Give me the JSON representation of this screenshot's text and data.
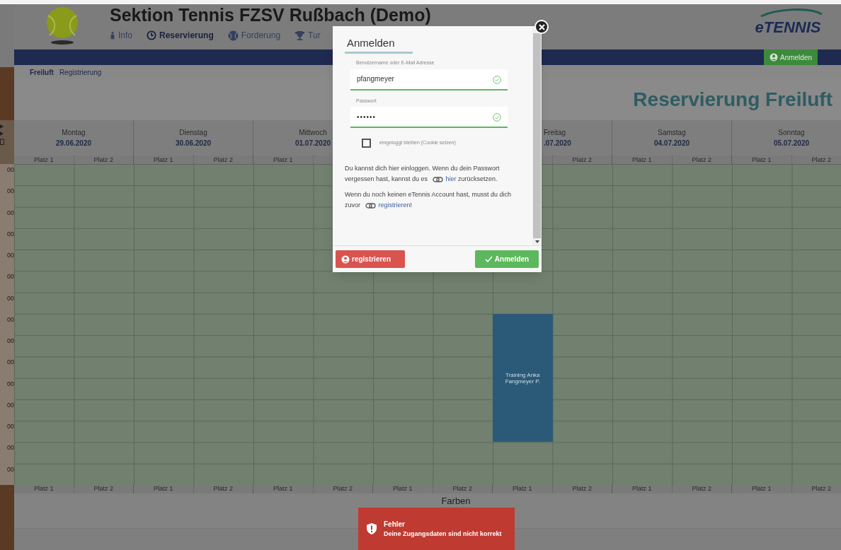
{
  "header": {
    "title": "Sektion Tennis FZSV Rußbach (Demo)",
    "nav": [
      {
        "label": "Info",
        "selected": false
      },
      {
        "label": "Reservierung",
        "selected": true
      },
      {
        "label": "Forderung",
        "selected": false
      },
      {
        "label": "Tur",
        "selected": false
      }
    ],
    "brand": "eTENNIS",
    "login_button": "Anmelden"
  },
  "subnav": [
    {
      "label": "Freiluft",
      "selected": true
    },
    {
      "label": "Registrierung",
      "selected": false
    }
  ],
  "page_title": "Reservierung Freiluft",
  "days_left": [
    {
      "label": "Montag",
      "date": "29.06.2020",
      "cut": false
    },
    {
      "label": "Dienstag",
      "date": "30.06.2020",
      "cut": false
    },
    {
      "label": "Mittwoch",
      "date": "01.07.2020",
      "cut": false
    }
  ],
  "days_right": [
    {
      "label": "Freitag",
      "date": ".07.2020",
      "cut": true
    },
    {
      "label": "Samstag",
      "date": "04.07.2020",
      "cut": false
    },
    {
      "label": "Sonntag",
      "date": "05.07.2020",
      "cut": false
    }
  ],
  "courts_top_left": [
    {
      "label": "Platz 1"
    },
    {
      "label": "Platz 2"
    },
    {
      "label": "Platz 1"
    },
    {
      "label": "Platz 2"
    },
    {
      "label": "Platz 1"
    }
  ],
  "courts_top_right": [
    {
      "label": "Platz 2"
    },
    {
      "label": "Platz 1"
    },
    {
      "label": "Platz 2"
    },
    {
      "label": "Platz 1"
    },
    {
      "label": "Platz 2"
    }
  ],
  "courts_bottom": [
    {
      "label": "Platz 1"
    },
    {
      "label": "Platz 2"
    },
    {
      "label": "Platz 1"
    },
    {
      "label": "Platz 2"
    },
    {
      "label": "Platz 1"
    },
    {
      "label": "Platz 2"
    },
    {
      "label": "Platz 1"
    },
    {
      "label": "Platz 2"
    },
    {
      "label": "Platz 1"
    },
    {
      "label": "Platz 2"
    },
    {
      "label": "Platz 1"
    },
    {
      "label": "Platz 2"
    },
    {
      "label": "Platz 1"
    },
    {
      "label": "Platz 2"
    }
  ],
  "time_labels": [
    "00",
    "00",
    "00",
    "00",
    "00",
    "00",
    "00",
    "00",
    "00",
    "00",
    "00",
    "00",
    "00",
    "00",
    "00"
  ],
  "booking": {
    "text": "Training Anka Fangmeyer P."
  },
  "legend_title": "Farben",
  "login_dialog": {
    "title": "Anmelden",
    "fields": [
      {
        "label": "Benutzername oder E-Mail Adresse",
        "value": "pfangmeyer",
        "kind": "text",
        "valid": true
      },
      {
        "label": "Passwort",
        "value": "••••••",
        "kind": "password",
        "valid": true
      }
    ],
    "remember": {
      "label": "eingeloggt bleiben (Cookie setzen)",
      "checked": false
    },
    "paragraphs": [
      [
        {
          "text": "Du kannst dich hier einloggen. Wenn du dein Passwort vergessen hast, kannst du es "
        },
        {
          "link": "hier"
        },
        {
          "text": " zurücksetzen."
        }
      ],
      [
        {
          "text": "Wenn du noch keinen eTennis Account hast, musst du dich zuvor "
        },
        {
          "link": "registrieren"
        },
        {
          "text": "!"
        }
      ]
    ],
    "buttons": [
      {
        "label": "registrieren",
        "kind": "danger"
      },
      {
        "label": "Anmelden",
        "kind": "primary"
      }
    ]
  },
  "toast": {
    "title": "Fehler",
    "message": "Deine Zugangsdaten sind nicht korrekt"
  }
}
